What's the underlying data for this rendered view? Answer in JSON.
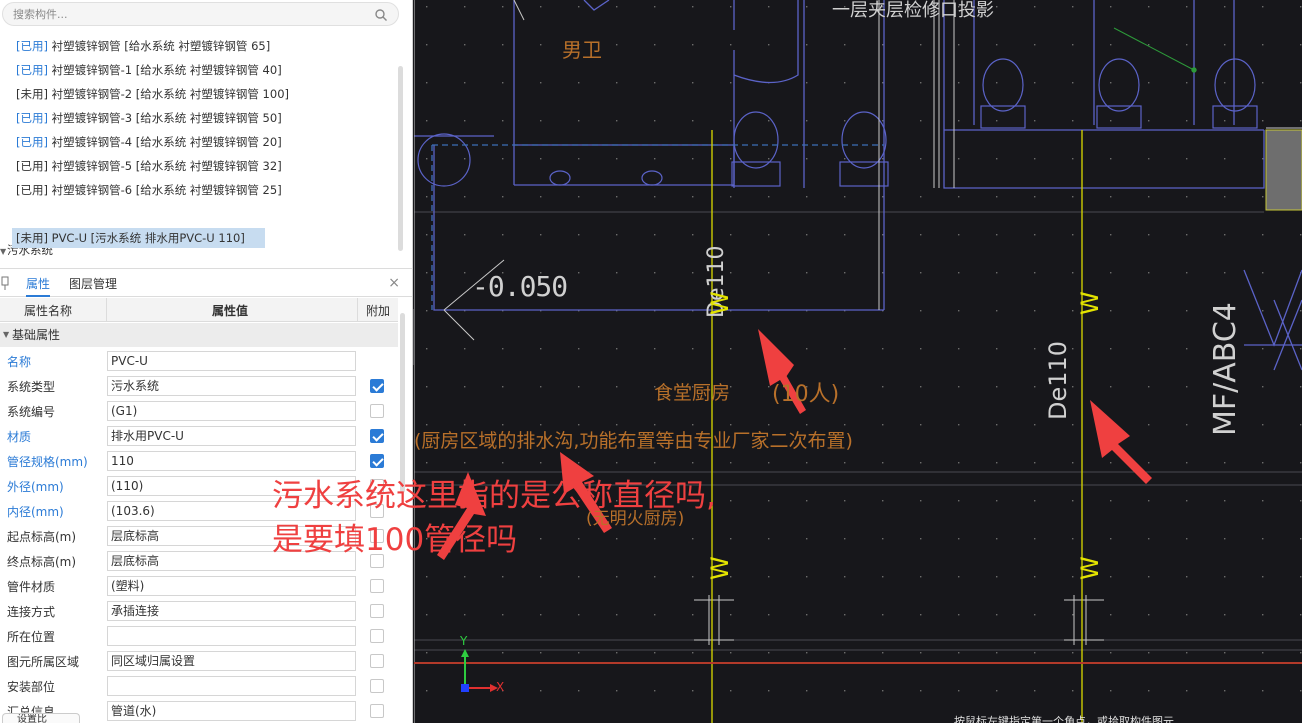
{
  "search": {
    "placeholder": "搜索构件..."
  },
  "tree": {
    "items": [
      {
        "status": "[已用]",
        "used": true,
        "label": "衬塑镀锌钢管 [给水系统 衬塑镀锌钢管 65]"
      },
      {
        "status": "[已用]",
        "used": true,
        "label": "衬塑镀锌钢管-1 [给水系统 衬塑镀锌钢管 40]"
      },
      {
        "status": "[未用]",
        "used": false,
        "label": "衬塑镀锌钢管-2 [给水系统 衬塑镀锌钢管 100]"
      },
      {
        "status": "[已用]",
        "used": true,
        "label": "衬塑镀锌钢管-3 [给水系统 衬塑镀锌钢管 50]"
      },
      {
        "status": "[已用]",
        "used": true,
        "label": "衬塑镀锌钢管-4 [给水系统 衬塑镀锌钢管 20]"
      },
      {
        "status": "[已用]",
        "used": false,
        "label": "衬塑镀锌钢管-5 [给水系统 衬塑镀锌钢管 32]"
      },
      {
        "status": "[已用]",
        "used": false,
        "label": "衬塑镀锌钢管-6 [给水系统 衬塑镀锌钢管 25]"
      }
    ],
    "group_sewage": "污水系统",
    "selected_item": "[未用] PVC-U [污水系统 排水用PVC-U 110]"
  },
  "panel": {
    "tab_props": "属性",
    "tab_layers": "图层管理",
    "close": "×",
    "col_name": "属性名称",
    "col_value": "属性值",
    "col_extra": "附加",
    "group_basic": "基础属性"
  },
  "properties": [
    {
      "name": "名称",
      "blue": true,
      "value": "PVC-U",
      "has_check": false,
      "checked": false
    },
    {
      "name": "系统类型",
      "blue": false,
      "value": "污水系统",
      "has_check": true,
      "checked": true
    },
    {
      "name": "系统编号",
      "blue": false,
      "value": "(G1)",
      "has_check": true,
      "checked": false
    },
    {
      "name": "材质",
      "blue": true,
      "value": "排水用PVC-U",
      "has_check": true,
      "checked": true
    },
    {
      "name": "管径规格(mm)",
      "blue": true,
      "value": "110",
      "has_check": true,
      "checked": true
    },
    {
      "name": "外径(mm)",
      "blue": true,
      "value": "(110)",
      "has_check": true,
      "checked": false
    },
    {
      "name": "内径(mm)",
      "blue": true,
      "value": "(103.6)",
      "has_check": true,
      "checked": false
    },
    {
      "name": "起点标高(m)",
      "blue": false,
      "value": "层底标高",
      "has_check": true,
      "checked": false
    },
    {
      "name": "终点标高(m)",
      "blue": false,
      "value": "层底标高",
      "has_check": true,
      "checked": false
    },
    {
      "name": "管件材质",
      "blue": false,
      "value": "(塑料)",
      "has_check": true,
      "checked": false
    },
    {
      "name": "连接方式",
      "blue": false,
      "value": "承插连接",
      "has_check": true,
      "checked": false
    },
    {
      "name": "所在位置",
      "blue": false,
      "value": "",
      "has_check": true,
      "checked": false
    },
    {
      "name": "图元所属区域",
      "blue": false,
      "value": "同区域归属设置",
      "has_check": true,
      "checked": false
    },
    {
      "name": "安装部位",
      "blue": false,
      "value": "",
      "has_check": true,
      "checked": false
    },
    {
      "name": "汇总信息",
      "blue": false,
      "value": "管道(水)",
      "has_check": true,
      "checked": false
    }
  ],
  "bottom_tab": "设置比",
  "cad": {
    "room_label": "男卫",
    "top_note": "一层夹层检修口投影",
    "elevation": "-0.050",
    "pipe_size_left": "De110",
    "pipe_size_right": "De110",
    "kitchen_title": "食堂厨房",
    "kitchen_count": "(10人)",
    "kitchen_note": "(厨房区域的排水沟,功能布置等由专业厂家二次布置)",
    "kitchen_sub": "(无明火厨房)",
    "grid_label": "MF/ABC4",
    "pipe_mark": "W",
    "axis_x": "X",
    "axis_y": "Y",
    "status_bar": "按鼠标左键指定第一个角点，或拾取构件图元"
  },
  "annotation": {
    "line1": "污水系统这里指的是公称直径吗,",
    "line2": "是要填100管径吗"
  },
  "colors": {
    "cad_background": "#17171b",
    "pipe_yellow": "#e3e300",
    "wall_blue": "#5b63c8",
    "text_orange": "#b8702a",
    "annotation_red": "#ef4040",
    "accent_blue": "#2b7bd6"
  }
}
